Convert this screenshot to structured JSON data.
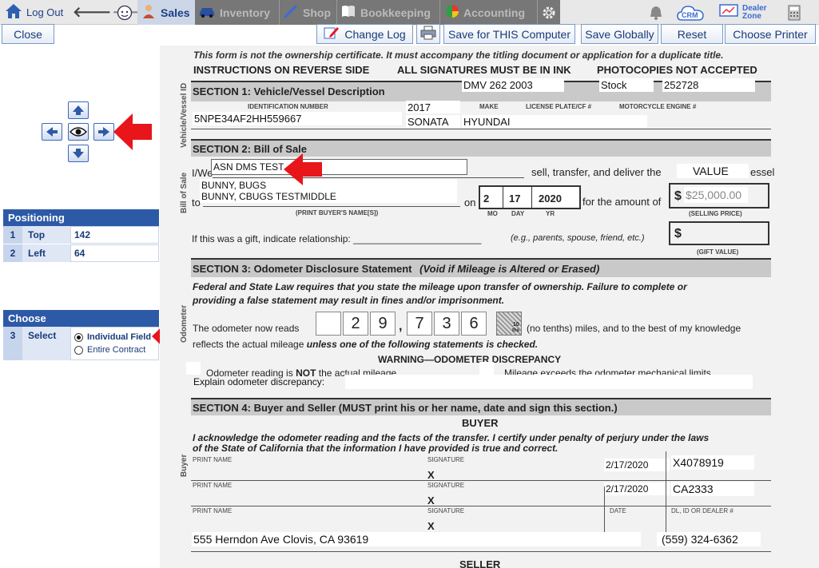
{
  "nav": {
    "logout": "Log Out",
    "tabs": [
      {
        "label": "Sales",
        "icon": "salesperson-icon"
      },
      {
        "label": "Inventory",
        "icon": "car-icon"
      },
      {
        "label": "Shop",
        "icon": "wrench-icon"
      },
      {
        "label": "Bookkeeping",
        "icon": "book-icon"
      },
      {
        "label": "Accounting",
        "icon": "pie-chart-icon"
      }
    ],
    "crm": "CRM",
    "dealer_zone": [
      "Dealer",
      "Zone"
    ]
  },
  "toolbar": {
    "close": "Close",
    "change_log": "Change Log",
    "save_computer": "Save for THIS Computer",
    "save_globally": "Save Globally",
    "reset": "Reset",
    "choose_printer": "Choose Printer"
  },
  "positioning": {
    "title": "Positioning",
    "rows": [
      {
        "num": "1",
        "label": "Top",
        "value": "142"
      },
      {
        "num": "2",
        "label": "Left",
        "value": "64"
      }
    ]
  },
  "choose": {
    "title": "Choose",
    "num": "3",
    "label": "Select",
    "options": [
      "Individual Field",
      "Entire Contract"
    ],
    "selected": "Individual Field"
  },
  "form": {
    "line1": "This form is not the ownership certificate. It must accompany the titling document or application for a duplicate title.",
    "line2a": "INSTRUCTIONS ON REVERSE SIDE",
    "line2b": "ALL SIGNATURES MUST BE IN INK",
    "line2c": "PHOTOCOPIES NOT ACCEPTED",
    "side_vehicle": "Vehicle/Vessel ID",
    "side_bill": "Bill of Sale",
    "side_odometer": "Odometer",
    "side_buyer": "Buyer",
    "sec1": "SECTION 1: Vehicle/Vessel Description",
    "dmv_form": "DMV 262 2003",
    "stock_label": "Stock",
    "stock_no": "252728",
    "lbl_id": "IDENTIFICATION NUMBER",
    "lbl_make": "MAKE",
    "lbl_plate": "LICENSE PLATE/CF #",
    "lbl_engine": "MOTORCYCLE ENGINE #",
    "vin": "5NPE34AF2HH559667",
    "year": "2017",
    "model": "SONATA",
    "make": "HYUNDAI",
    "sec2": "SECTION 2: Bill of Sale",
    "iwe": "I/We",
    "seller": "ASN DMS TEST",
    "sell_text": "sell, transfer, and deliver the",
    "value_field": "VALUE",
    "vessel_tail": "essel",
    "to": "to",
    "buyer1": "BUNNY, BUGS",
    "buyer2": "BUNNY, CBUGS TESTMIDDLE",
    "print_buyer": "(PRINT BUYER'S NAME[S])",
    "on": "on",
    "mo": "2",
    "day": "17",
    "yr": "2020",
    "lbl_mo": "MO",
    "lbl_day": "DAY",
    "lbl_yr": "YR",
    "amount_text": "for the amount of",
    "dollar": "$",
    "price": "$25,000.00",
    "selling_price": "(SELLING PRICE)",
    "gift_q": "If this was a gift, indicate relationship: ________________________",
    "gift_eg": "(e.g., parents, spouse, friend, etc.)",
    "gift_value": "(GIFT VALUE)",
    "sec3": "SECTION 3: Odometer Disclosure Statement",
    "sec3_note": "(Void if Mileage is Altered or Erased)",
    "fed1": "Federal and State Law requires that you state the mileage upon transfer of ownership. Failure to complete or",
    "fed2": "providing a false statement may result in fines and/or imprisonment.",
    "odo_reads": "The odometer now reads",
    "odo_digits": [
      "",
      "2",
      "9",
      "7",
      "3",
      "6"
    ],
    "odo_comma": ",",
    "tenths_a": "10",
    "tenths_b": "ths",
    "no_tenths": "(no tenths) miles, and to the best of my knowledge",
    "reflects": "reflects the actual mileage",
    "unless": "unless one of the following statements is checked.",
    "warning": "WARNING—ODOMETER DISCREPANCY",
    "not_actual_a": "Odometer reading is",
    "not_actual_b": "NOT",
    "not_actual_c": "the actual mileage",
    "exceeds": "Mileage exceeds the odometer mechanical limits",
    "explain": "Explain odometer discrepancy:",
    "sec4": "SECTION 4: Buyer and Seller (MUST print his or her name, date and sign this section.)",
    "buyer_hdr": "BUYER",
    "ack1": "I acknowledge the odometer reading and the facts of the transfer. I certify under penalty of perjury under the laws",
    "ack2": "of the State of California that the information I have provided is true and correct.",
    "print_name": "PRINT NAME",
    "signature": "SIGNATURE",
    "x_mark": "X",
    "date_lbl": "DATE",
    "dl_lbl": "DL, ID OR DEALER #",
    "date1": "2/17/2020",
    "dl1": "X4078919",
    "date2": "2/17/2020",
    "dl2": "CA2333",
    "address": "555 Herndon Ave  Clovis, CA  93619",
    "phone": "(559) 324-6362",
    "seller_hdr": "SELLER"
  },
  "colors": {
    "panel_header": "#2d5aa6",
    "nav_active_bg": "#ccd6e6",
    "annotation_arrow": "#e8151b"
  }
}
